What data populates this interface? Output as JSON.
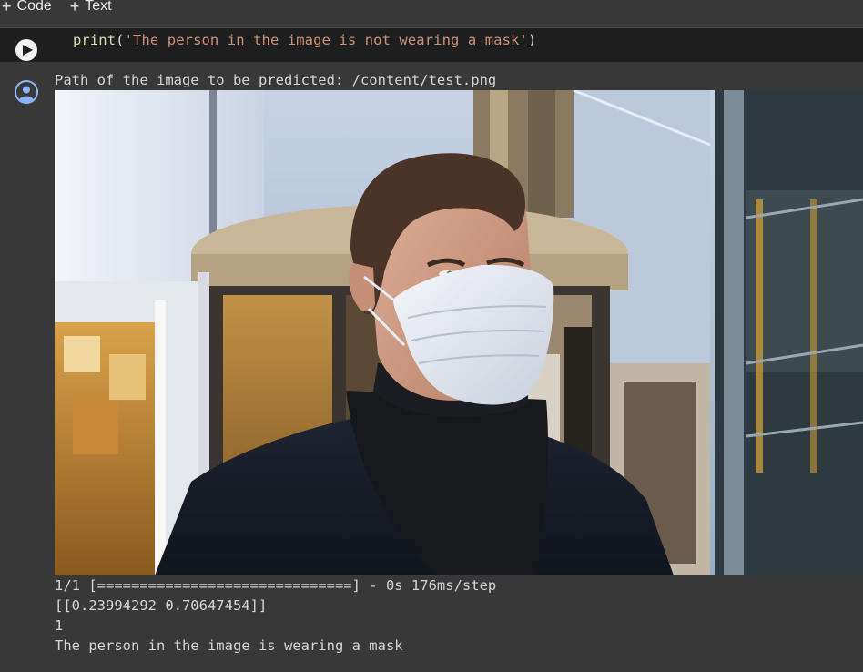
{
  "toolbar": {
    "code_label": "Code",
    "text_label": "Text",
    "plus_symbol": "+"
  },
  "cell": {
    "code": {
      "fn": "print",
      "open": "(",
      "string": "'The person in the image is not wearing a mask'",
      "close": ")"
    }
  },
  "output": {
    "path_line": "Path of the image to be predicted: /content/test.png",
    "image_alt": "Man wearing a white surgical face mask and dark scarf in front of a revolving glass door",
    "progress_line": "1/1 [==============================] - 0s 176ms/step",
    "prediction_line": "[[0.23994292 0.70647454]]",
    "class_line": "1",
    "result_line": "The person in the image is wearing a mask"
  },
  "colors": {
    "cell_bg": "#1e1e1e",
    "page_bg": "#383838",
    "code_string": "#ce9178",
    "code_function": "#dcdcaa",
    "output_text": "#d5d5d5",
    "output_icon": "#8ab4f8"
  },
  "icons": {
    "run": "play-icon",
    "output": "user-avatar-icon"
  }
}
